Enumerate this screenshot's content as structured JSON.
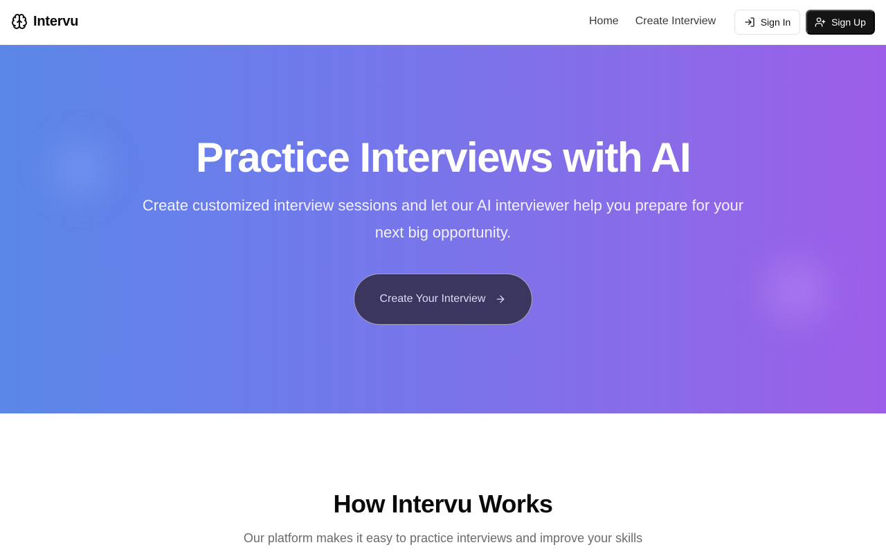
{
  "brand": {
    "name": "Intervu",
    "icon": "brain-icon"
  },
  "nav": {
    "links": [
      "Home",
      "Create Interview"
    ],
    "sign_in_label": "Sign In",
    "sign_in_icon": "log-in-icon",
    "sign_up_label": "Sign Up",
    "sign_up_icon": "user-plus-icon"
  },
  "hero": {
    "title": "Practice Interviews with AI",
    "subtitle": "Create customized interview sessions and let our AI interviewer help you prepare for your next big opportunity.",
    "cta_label": "Create Your Interview",
    "cta_icon": "arrow-right-icon"
  },
  "how": {
    "title": "How Intervu Works",
    "subtitle": "Our platform makes it easy to practice interviews and improve your skills"
  },
  "colors": {
    "hero_gradient_start": "#5a87e8",
    "hero_gradient_end": "#9d5ee8",
    "cta_background": "#3b365f",
    "sign_up_background": "#141414"
  }
}
